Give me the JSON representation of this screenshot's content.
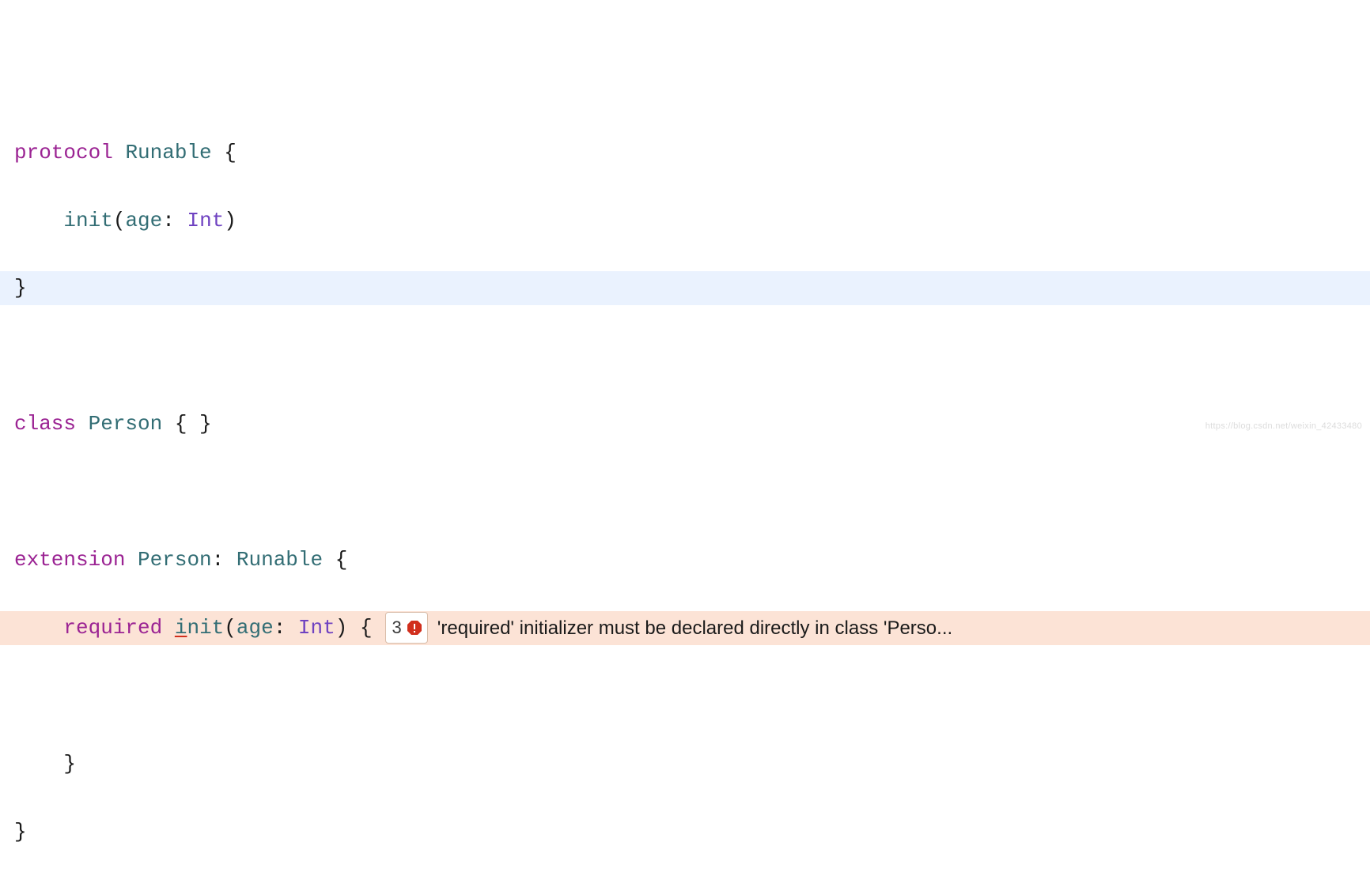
{
  "code": {
    "line1": {
      "kw_protocol": "protocol",
      "name": "Runable",
      "brace_open": " {"
    },
    "line2": {
      "indent": "    ",
      "fn": "init",
      "paren_open": "(",
      "param": "age",
      "colon": ": ",
      "type": "Int",
      "paren_close": ")"
    },
    "line3": {
      "brace_close": "}"
    },
    "line5": {
      "kw_class": "class",
      "name": "Person",
      "braces": " { }"
    },
    "line7": {
      "kw_extension": "extension",
      "name": "Person",
      "colon": ": ",
      "proto": "Runable",
      "brace_open": " {"
    },
    "line8": {
      "indent": "    ",
      "kw_required": "required",
      "space": " ",
      "fn_prefix": "i",
      "fn_rest": "nit",
      "paren_open": "(",
      "param": "age",
      "colon": ": ",
      "type": "Int",
      "paren_close_brace": ") {"
    },
    "line10": {
      "indent": "    ",
      "brace_close": "}"
    },
    "line11": {
      "brace_close": "}"
    }
  },
  "error": {
    "count": "3",
    "message": "'required' initializer must be declared directly in class 'Perso..."
  },
  "watermark": "https://blog.csdn.net/weixin_42433480"
}
